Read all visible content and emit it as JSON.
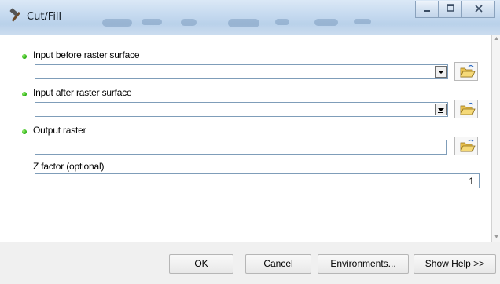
{
  "window": {
    "title": "Cut/Fill",
    "icons": {
      "title": "hammer-icon",
      "minimize": "minimize-icon",
      "maximize": "maximize-icon",
      "close": "close-icon"
    }
  },
  "form": {
    "params": [
      {
        "label": "Input before raster surface",
        "required": true,
        "value": "",
        "type": "dropdown"
      },
      {
        "label": "Input after raster surface",
        "required": true,
        "value": "",
        "type": "dropdown"
      },
      {
        "label": "Output raster",
        "required": true,
        "value": "",
        "type": "text"
      },
      {
        "label": "Z factor (optional)",
        "required": false,
        "value": "1",
        "type": "text"
      }
    ],
    "browse_icon": "open-folder-icon",
    "required_indicator_color": "#2eb516"
  },
  "buttons": {
    "ok": "OK",
    "cancel": "Cancel",
    "environments": "Environments...",
    "show_help": "Show Help >>"
  }
}
